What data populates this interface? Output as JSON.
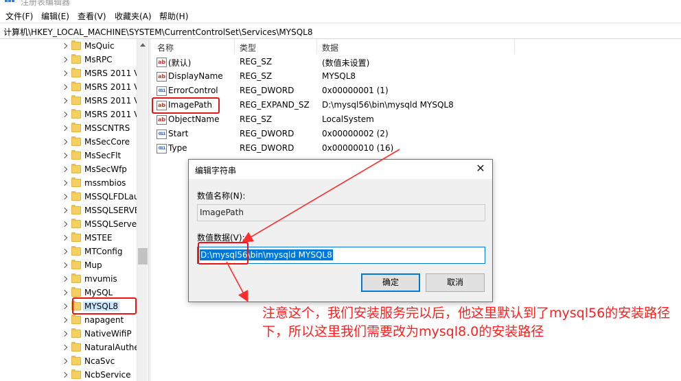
{
  "window": {
    "title": "注册表编辑器"
  },
  "menu": [
    "文件(F)",
    "编辑(E)",
    "查看(V)",
    "收藏夹(A)",
    "帮助(H)"
  ],
  "address": "计算机\\HKEY_LOCAL_MACHINE\\SYSTEM\\CurrentControlSet\\Services\\MYSQL8",
  "tree": [
    "MsQuic",
    "MsRPC",
    "MSRS 2011 V",
    "MSRS 2011 V",
    "MSRS 2011 V",
    "MSRS 2011 V",
    "MSSCNTRS",
    "MsSecCore",
    "MsSecFlt",
    "MsSecWfp",
    "mssmbios",
    "MSSQLFDLau",
    "MSSQLSERVE",
    "MSSQLServe",
    "MSTEE",
    "MTConfig",
    "Mup",
    "mvumis",
    "MySQL",
    "MYSQL8",
    "napagent",
    "NativeWifiP",
    "NaturalAuthe",
    "NcaSvc",
    "NcbService"
  ],
  "tree_selected": "MYSQL8",
  "list": {
    "headers": {
      "name": "名称",
      "type": "类型",
      "data": "数据"
    },
    "rows": [
      {
        "icon": "string-value-icon",
        "name": "(默认)",
        "type": "REG_SZ",
        "data": "(数值未设置)"
      },
      {
        "icon": "string-value-icon",
        "name": "DisplayName",
        "type": "REG_SZ",
        "data": "MYSQL8"
      },
      {
        "icon": "binary-value-icon",
        "name": "ErrorControl",
        "type": "REG_DWORD",
        "data": "0x00000001 (1)"
      },
      {
        "icon": "string-value-icon",
        "name": "ImagePath",
        "type": "REG_EXPAND_SZ",
        "data": "D:\\mysql56\\bin\\mysqld MYSQL8"
      },
      {
        "icon": "string-value-icon",
        "name": "ObjectName",
        "type": "REG_SZ",
        "data": "LocalSystem"
      },
      {
        "icon": "binary-value-icon",
        "name": "Start",
        "type": "REG_DWORD",
        "data": "0x00000002 (2)"
      },
      {
        "icon": "binary-value-icon",
        "name": "Type",
        "type": "REG_DWORD",
        "data": "0x00000010 (16)"
      }
    ]
  },
  "icon_glyphs": {
    "string": "ab",
    "binary": "011"
  },
  "dialog": {
    "title": "编辑字符串",
    "close": "✕",
    "name_label": "数值名称(N):",
    "name_value": "ImagePath",
    "data_label": "数值数据(V):",
    "data_value": "D:\\mysql56\\bin\\mysqld MYSQL8",
    "ok": "确定",
    "cancel": "取消"
  },
  "annotation": "注意这个，我们安装服务完以后，他这里默认到了mysql56的安装路径下，所以这里我们需要改为mysql8.0的安装路径",
  "colors": {
    "highlight_red": "#e61414",
    "annotation_red": "#ff1f1f",
    "selection_blue": "#0078d7"
  }
}
